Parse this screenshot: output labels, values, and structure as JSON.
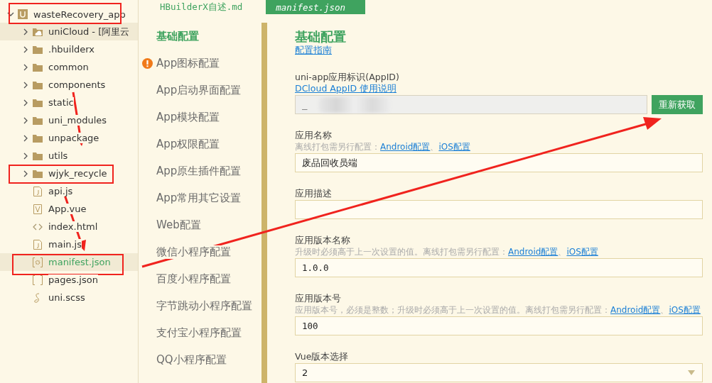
{
  "file_tree": {
    "root": {
      "label": "wasteRecovery_app",
      "expanded": true,
      "children": [
        {
          "label": "uniCloud - [阿里云",
          "kind": "cloud-folder",
          "expanded": false,
          "selected": false,
          "hovered": true
        },
        {
          "label": ".hbuilderx",
          "kind": "folder",
          "expanded": false,
          "selected": false,
          "hovered": false
        },
        {
          "label": "common",
          "kind": "folder",
          "expanded": false,
          "selected": false,
          "hovered": false
        },
        {
          "label": "components",
          "kind": "folder",
          "expanded": false,
          "selected": false,
          "hovered": false
        },
        {
          "label": "static",
          "kind": "folder",
          "expanded": false,
          "selected": false,
          "hovered": false
        },
        {
          "label": "uni_modules",
          "kind": "folder",
          "expanded": false,
          "selected": false,
          "hovered": false
        },
        {
          "label": "unpackage",
          "kind": "folder",
          "expanded": false,
          "selected": false,
          "hovered": false
        },
        {
          "label": "utils",
          "kind": "folder",
          "expanded": false,
          "selected": false,
          "hovered": false
        },
        {
          "label": "wjyk_recycle",
          "kind": "folder",
          "expanded": false,
          "selected": false,
          "hovered": false
        },
        {
          "label": "api.js",
          "kind": "js",
          "selected": false,
          "hovered": false
        },
        {
          "label": "App.vue",
          "kind": "vue",
          "selected": false,
          "hovered": false
        },
        {
          "label": "index.html",
          "kind": "html",
          "selected": false,
          "hovered": false
        },
        {
          "label": "main.js",
          "kind": "js",
          "selected": false,
          "hovered": false
        },
        {
          "label": "manifest.json",
          "kind": "config",
          "selected": true,
          "hovered": false
        },
        {
          "label": "pages.json",
          "kind": "json",
          "selected": false,
          "hovered": false
        },
        {
          "label": "uni.scss",
          "kind": "style",
          "selected": false,
          "hovered": false
        }
      ]
    }
  },
  "tabs": [
    {
      "label": "HBuilderX自述.md",
      "selected": false
    },
    {
      "label": "manifest.json",
      "selected": true
    }
  ],
  "nav_items": [
    {
      "label": "基础配置",
      "selected": true,
      "warning": false
    },
    {
      "label": "App图标配置",
      "selected": false,
      "warning": true
    },
    {
      "label": "App启动界面配置",
      "selected": false,
      "warning": false
    },
    {
      "label": "App模块配置",
      "selected": false,
      "warning": false
    },
    {
      "label": "App权限配置",
      "selected": false,
      "warning": false
    },
    {
      "label": "App原生插件配置",
      "selected": false,
      "warning": false
    },
    {
      "label": "App常用其它设置",
      "selected": false,
      "warning": false
    },
    {
      "label": "Web配置",
      "selected": false,
      "warning": false
    },
    {
      "label": "微信小程序配置",
      "selected": false,
      "warning": false
    },
    {
      "label": "百度小程序配置",
      "selected": false,
      "warning": false
    },
    {
      "label": "字节跳动小程序配置",
      "selected": false,
      "warning": false
    },
    {
      "label": "支付宝小程序配置",
      "selected": false,
      "warning": false
    },
    {
      "label": "QQ小程序配置",
      "selected": false,
      "warning": false
    }
  ],
  "form": {
    "title": "基础配置",
    "guide_link": "配置指南",
    "fields": [
      {
        "kind": "input",
        "label": "uni-app应用标识(AppID)",
        "link": "DCloud AppID 使用说明",
        "value": "_",
        "readonly": true,
        "blurred": true,
        "button": "重新获取"
      },
      {
        "kind": "input",
        "label": "应用名称",
        "hint": "离线打包需另行配置：",
        "hint_links": [
          "Android配置",
          "iOS配置"
        ],
        "separator": "、",
        "value": "废品回收员端",
        "readonly": false,
        "blurred": false
      },
      {
        "kind": "input",
        "label": "应用描述",
        "readonly": false,
        "blurred": false
      },
      {
        "kind": "input",
        "label": "应用版本名称",
        "hint": "升级时必须高于上一次设置的值。离线打包需另行配置：",
        "hint_links": [
          "Android配置",
          "iOS配置"
        ],
        "separator": "、",
        "value": "1.0.0",
        "readonly": false,
        "blurred": false
      },
      {
        "kind": "input",
        "label": "应用版本号",
        "hint": "应用版本号，必须是整数；升级时必须高于上一次设置的值。离线打包需另行配置：",
        "hint_links": [
          "Android配置",
          "iOS配置"
        ],
        "separator": "、",
        "value": "100",
        "readonly": false,
        "blurred": false
      },
      {
        "kind": "select",
        "label": "Vue版本选择",
        "value": "2"
      }
    ]
  }
}
